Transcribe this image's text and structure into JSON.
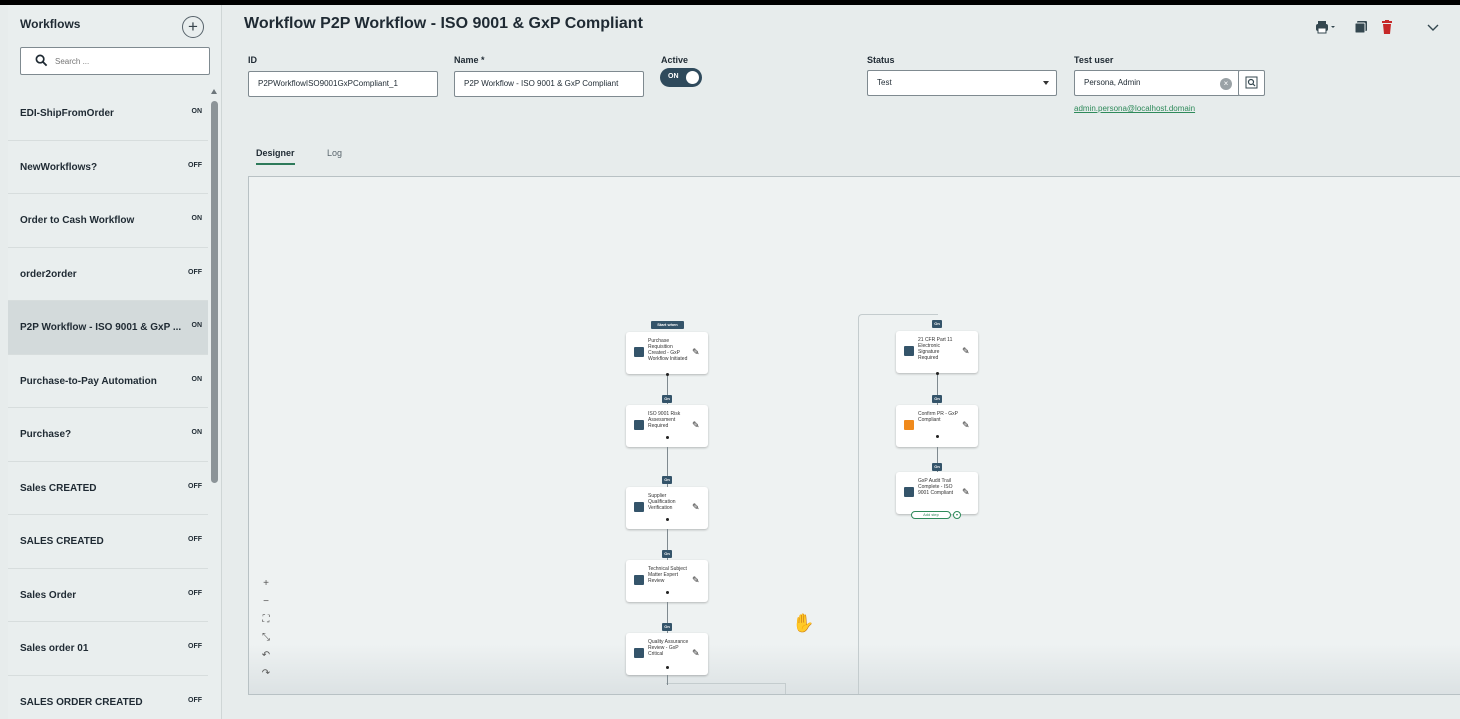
{
  "sidebar": {
    "title": "Workflows",
    "search_placeholder": "Search ...",
    "items": [
      {
        "label": "EDI-ShipFromOrder",
        "status": "ON"
      },
      {
        "label": "NewWorkflows?",
        "status": "OFF"
      },
      {
        "label": "Order to Cash Workflow",
        "status": "ON"
      },
      {
        "label": "order2order",
        "status": "OFF"
      },
      {
        "label": "P2P Workflow - ISO 9001 & GxP ...",
        "status": "ON",
        "selected": true
      },
      {
        "label": "Purchase-to-Pay Automation",
        "status": "ON"
      },
      {
        "label": "Purchase?",
        "status": "ON"
      },
      {
        "label": "Sales CREATED",
        "status": "OFF"
      },
      {
        "label": "SALES CREATED",
        "status": "OFF"
      },
      {
        "label": "Sales Order",
        "status": "OFF"
      },
      {
        "label": "Sales order 01",
        "status": "OFF"
      },
      {
        "label": "SALES ORDER CREATED",
        "status": "OFF"
      }
    ]
  },
  "header": {
    "title": "Workflow P2P Workflow - ISO 9001 & GxP Compliant"
  },
  "form": {
    "id_label": "ID",
    "id_value": "P2PWorkflowISO9001GxPCompliant_1",
    "name_label": "Name *",
    "name_value": "P2P Workflow - ISO 9001 & GxP Compliant",
    "active_label": "Active",
    "active_value": "ON",
    "status_label": "Status",
    "status_value": "Test",
    "test_user_label": "Test user",
    "test_user_value": "Persona, Admin",
    "test_user_email": "admin.persona@localhost.domain"
  },
  "tabs": [
    {
      "label": "Designer",
      "active": true
    },
    {
      "label": "Log",
      "active": false
    }
  ],
  "designer": {
    "start_badge": "Start when",
    "on_badge": "On",
    "add_step": "Add step",
    "nodes_left": [
      {
        "text": "Purchase Requisition Created - GxP Workflow Initiated"
      },
      {
        "text": "ISO 9001 Risk Assessment Required"
      },
      {
        "text": "Supplier Qualification Verification"
      },
      {
        "text": "Technical Subject Matter Expert Review"
      },
      {
        "text": "Quality Assurance Review - GxP Critical"
      }
    ],
    "nodes_right": [
      {
        "text": "21 CFR Part 11 Electronic Signature Required"
      },
      {
        "text": "Confirm PR - GxP Compliant"
      },
      {
        "text": "GxP Audit Trail Complete - ISO 9001 Compliant"
      }
    ],
    "zoom_controls": [
      "+",
      "−",
      "⛶",
      "⤡",
      "↶",
      "↷"
    ]
  },
  "colors": {
    "accent_dark": "#2f4a5c",
    "link_green": "#2e8a5a",
    "delete_red": "#c62828"
  }
}
